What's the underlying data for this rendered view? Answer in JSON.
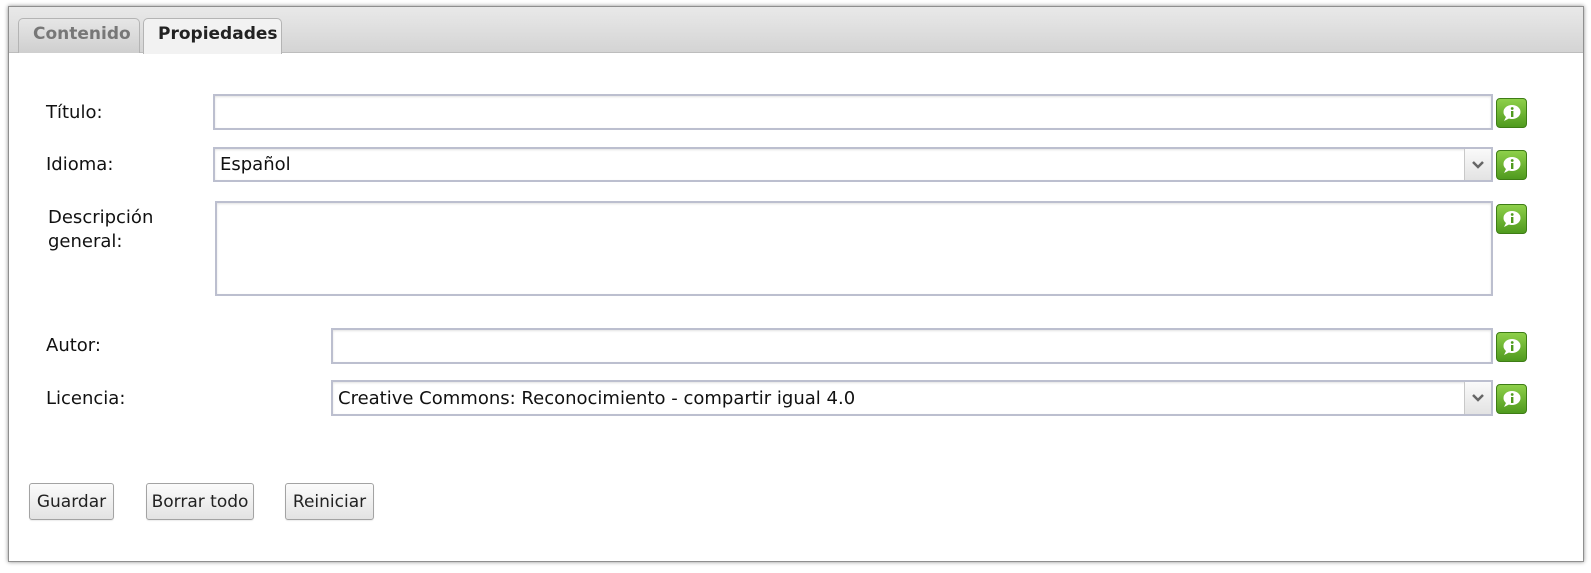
{
  "tabs": {
    "contenido": "Contenido",
    "propiedades": "Propiedades",
    "active": "Propiedades"
  },
  "form": {
    "titulo": {
      "label": "Título:",
      "value": ""
    },
    "idioma": {
      "label": "Idioma:",
      "selected": "Español"
    },
    "descripcion": {
      "label_line1": "Descripción",
      "label_line2": "general:",
      "value": ""
    },
    "autor": {
      "label": "Autor:",
      "value": ""
    },
    "licencia": {
      "label": "Licencia:",
      "selected": "Creative Commons: Reconocimiento - compartir igual 4.0"
    }
  },
  "buttons": {
    "guardar": "Guardar",
    "borrar": "Borrar todo",
    "reiniciar": "Reiniciar"
  },
  "icons": {
    "info": "info-icon",
    "dropdown": "chevron-down-icon"
  },
  "colors": {
    "info_green": "#5fae28",
    "field_border": "#bcbfcf"
  }
}
